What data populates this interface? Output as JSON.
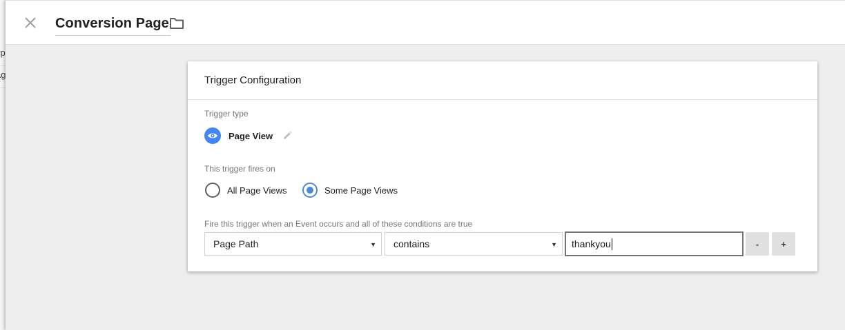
{
  "background_page": {
    "fragment_1": "yp",
    "fragment_2": "ag"
  },
  "header": {
    "close_icon": "close-icon",
    "title": "Conversion Page",
    "folder_icon": "folder-icon"
  },
  "card": {
    "title": "Trigger Configuration",
    "trigger_type_label": "Trigger type",
    "trigger_type": {
      "icon": "eye-icon",
      "name": "Page View",
      "edit_icon": "pencil-icon"
    },
    "fires_on_label": "This trigger fires on",
    "fires_on_options": [
      {
        "label": "All Page Views",
        "selected": false
      },
      {
        "label": "Some Page Views",
        "selected": true
      }
    ],
    "condition_label": "Fire this trigger when an Event occurs and all of these conditions are true",
    "condition": {
      "variable": "Page Path",
      "operator": "contains",
      "value": "thankyou",
      "remove_label": "-",
      "add_label": "+"
    }
  },
  "colors": {
    "accent": "#4285f4",
    "radio_selected": "#4a89dc",
    "sheet_background": "#eeeeee"
  }
}
